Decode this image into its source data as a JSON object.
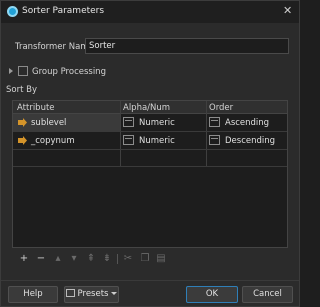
{
  "window": {
    "title": "Sorter Parameters"
  },
  "form": {
    "transformer_name_label": "Transformer Name:",
    "transformer_name_value": "Sorter",
    "group_processing_label": "Group Processing",
    "sort_by_label": "Sort By"
  },
  "table": {
    "columns": [
      "Attribute",
      "Alpha/Num",
      "Order"
    ],
    "rows": [
      {
        "attribute": "sublevel",
        "alpha_num": "Numeric",
        "order": "Ascending",
        "icon": "attribute-icon"
      },
      {
        "attribute": "_copynum",
        "alpha_num": "Numeric",
        "order": "Descending",
        "icon": "attribute-icon"
      }
    ]
  },
  "toolbar": {
    "add": "+",
    "remove": "−",
    "icons": [
      "add-icon",
      "remove-icon",
      "move-up-icon",
      "move-down-icon",
      "move-top-icon",
      "move-bottom-icon",
      "cut-icon",
      "copy-icon",
      "paste-icon"
    ]
  },
  "buttons": {
    "help": "Help",
    "presets": "Presets",
    "ok": "OK",
    "cancel": "Cancel"
  },
  "colors": {
    "accent": "#21a1d6",
    "attribute_icon": "#d4942a",
    "ok_border": "#2f7fb8"
  }
}
